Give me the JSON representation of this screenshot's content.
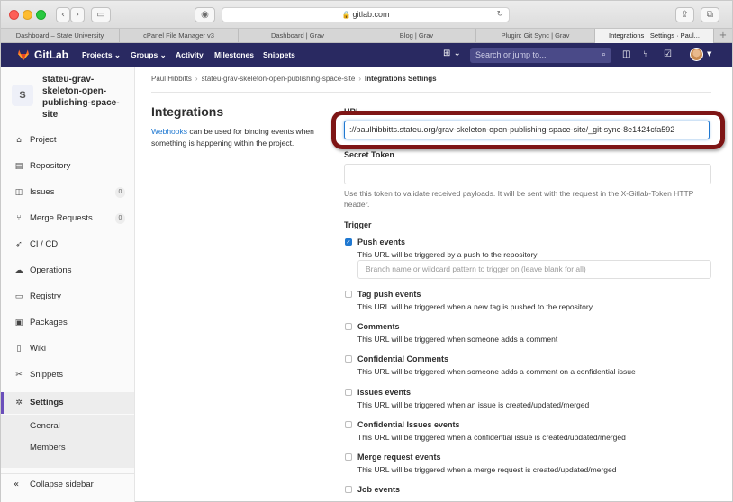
{
  "browser": {
    "address": "gitlab.com",
    "tabs": [
      {
        "label": "Dashboard – State University"
      },
      {
        "label": "cPanel File Manager v3"
      },
      {
        "label": "Dashboard | Grav"
      },
      {
        "label": "Blog | Grav"
      },
      {
        "label": "Plugin: Git Sync | Grav"
      },
      {
        "label": "Integrations · Settings · Paul..."
      }
    ]
  },
  "header": {
    "brand": "GitLab",
    "nav": [
      "Projects ⌄",
      "Groups ⌄",
      "Activity",
      "Milestones",
      "Snippets"
    ],
    "search_placeholder": "Search or jump to..."
  },
  "sidebar": {
    "avatar_letter": "S",
    "project_name": "stateu-grav-skeleton-open-publishing-space-site",
    "items": [
      {
        "label": "Project",
        "icon": "home-icon"
      },
      {
        "label": "Repository",
        "icon": "book-icon"
      },
      {
        "label": "Issues",
        "icon": "issues-icon",
        "count": "0"
      },
      {
        "label": "Merge Requests",
        "icon": "merge-request-icon",
        "count": "0"
      },
      {
        "label": "CI / CD",
        "icon": "rocket-icon"
      },
      {
        "label": "Operations",
        "icon": "cloud-gear-icon"
      },
      {
        "label": "Registry",
        "icon": "container-icon"
      },
      {
        "label": "Packages",
        "icon": "package-icon"
      },
      {
        "label": "Wiki",
        "icon": "wiki-icon"
      },
      {
        "label": "Snippets",
        "icon": "scissors-icon"
      },
      {
        "label": "Settings",
        "icon": "gear-icon"
      }
    ],
    "settings_sub": [
      "General",
      "Members"
    ],
    "collapse_label": "Collapse sidebar"
  },
  "breadcrumb": [
    "Paul Hibbitts",
    "stateu-grav-skeleton-open-publishing-space-site",
    "Integrations Settings"
  ],
  "main": {
    "title": "Integrations",
    "desc_link": "Webhooks",
    "desc_rest": " can be used for binding events when something is happening within the project.",
    "url_label": "URL",
    "url_value": "://paulhibbitts.stateu.org/grav-skeleton-open-publishing-space-site/_git-sync-8e1424cfa592",
    "token_label": "Secret Token",
    "token_help": "Use this token to validate received payloads. It will be sent with the request in the X-Gitlab-Token HTTP header.",
    "trigger_label": "Trigger",
    "branch_placeholder": "Branch name or wildcard pattern to trigger on (leave blank for all)",
    "triggers": [
      {
        "name": "Push events",
        "desc": "This URL will be triggered by a push to the repository",
        "checked": true
      },
      {
        "name": "Tag push events",
        "desc": "This URL will be triggered when a new tag is pushed to the repository",
        "checked": false
      },
      {
        "name": "Comments",
        "desc": "This URL will be triggered when someone adds a comment",
        "checked": false
      },
      {
        "name": "Confidential Comments",
        "desc": "This URL will be triggered when someone adds a comment on a confidential issue",
        "checked": false
      },
      {
        "name": "Issues events",
        "desc": "This URL will be triggered when an issue is created/updated/merged",
        "checked": false
      },
      {
        "name": "Confidential Issues events",
        "desc": "This URL will be triggered when a confidential issue is created/updated/merged",
        "checked": false
      },
      {
        "name": "Merge request events",
        "desc": "This URL will be triggered when a merge request is created/updated/merged",
        "checked": false
      },
      {
        "name": "Job events",
        "desc": "",
        "checked": false
      }
    ]
  },
  "colors": {
    "header_bg": "#292961",
    "accent": "#6b4fbb",
    "link": "#1f78d1",
    "highlight": "#7e1515"
  }
}
